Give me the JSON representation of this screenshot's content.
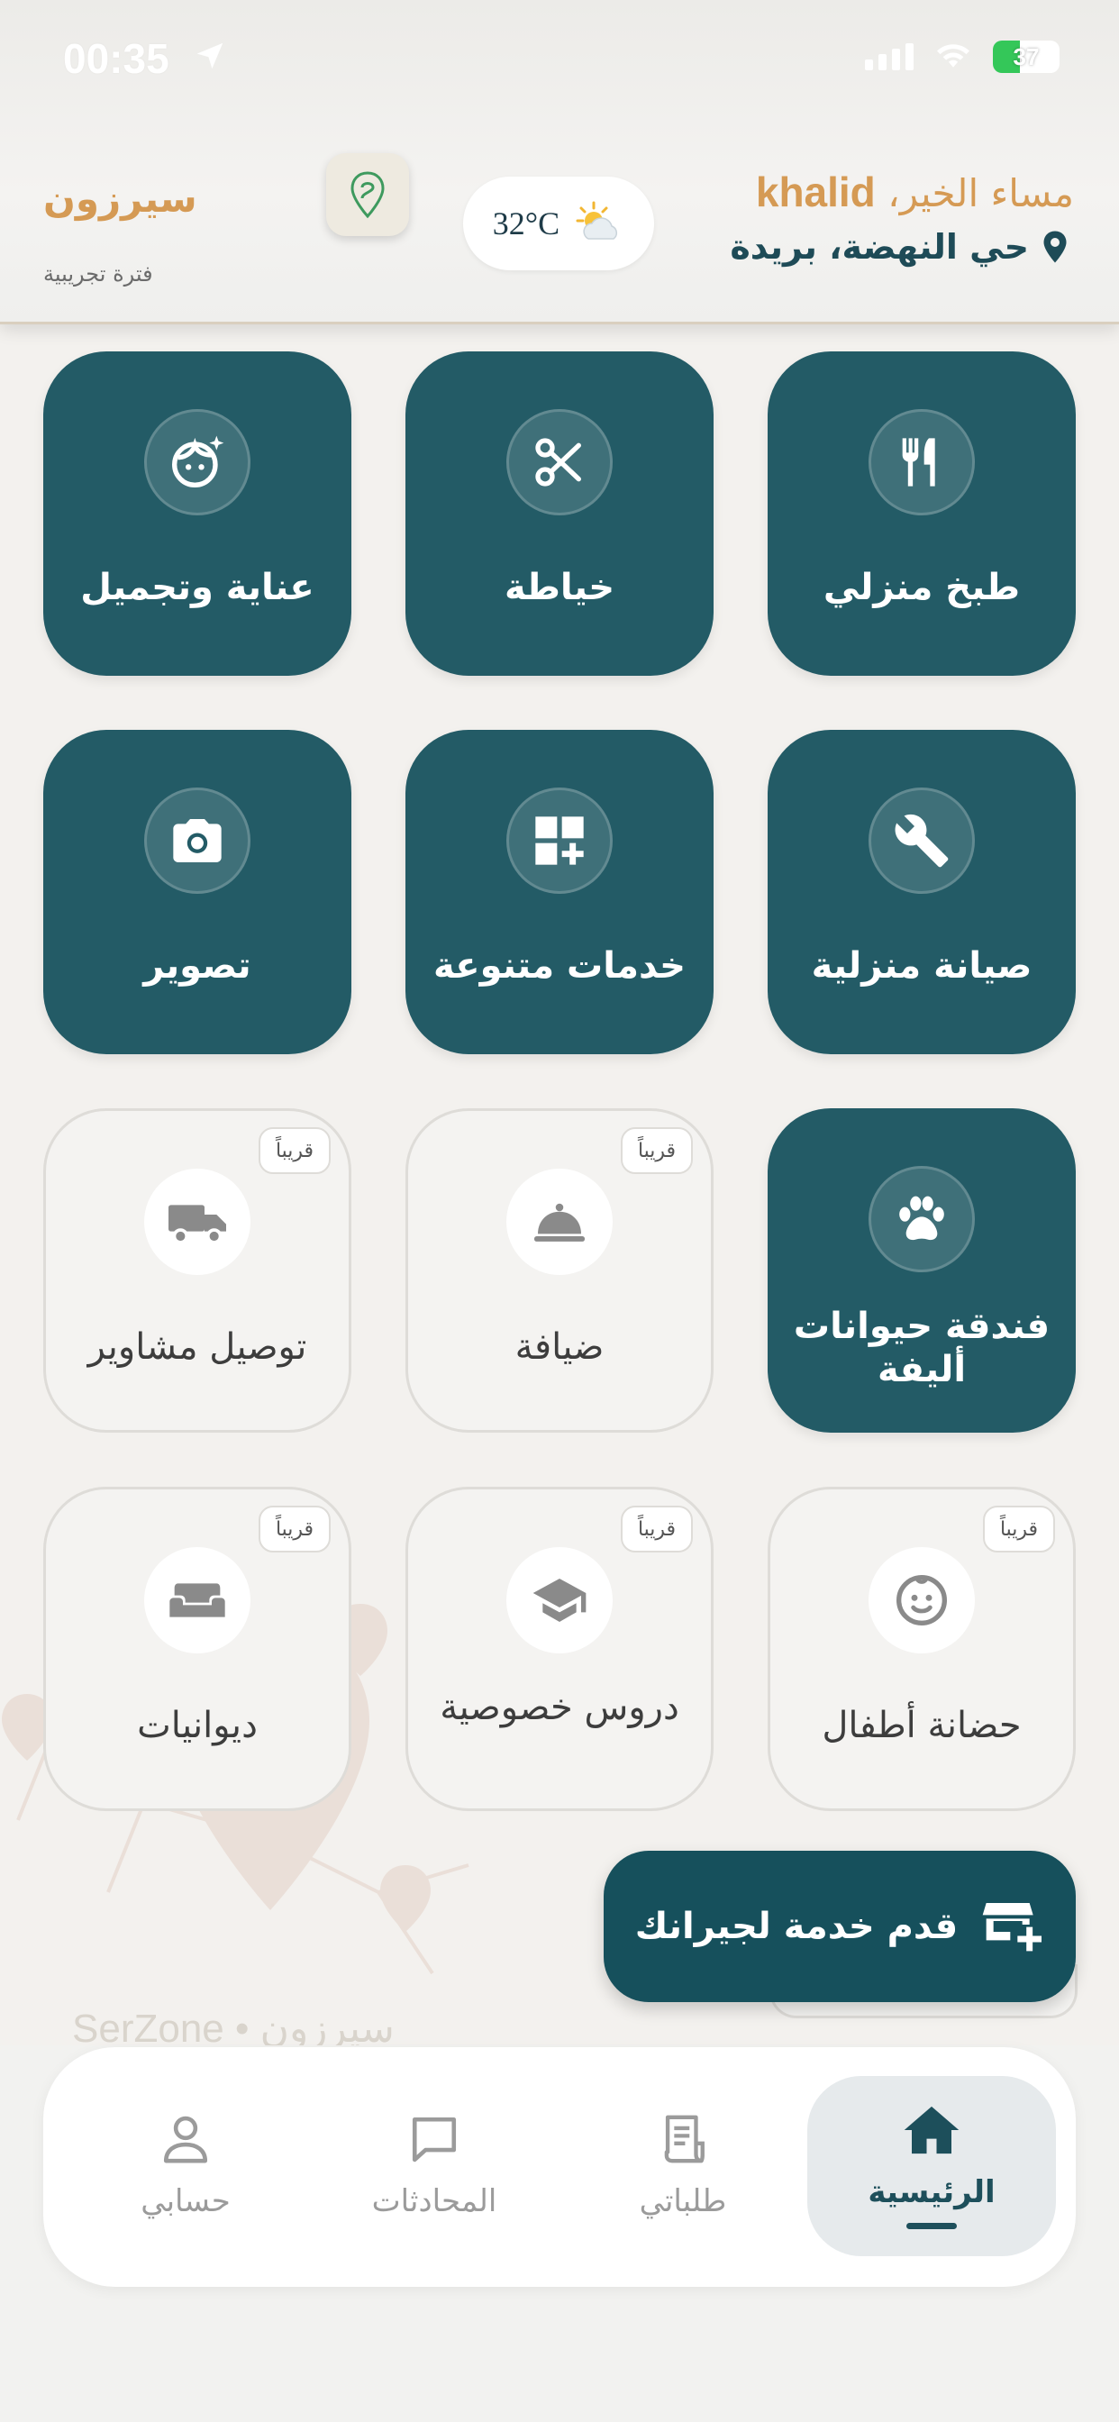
{
  "status_bar": {
    "time": "00:35",
    "battery": "37"
  },
  "header": {
    "greeting_prefix": "مساء الخير،",
    "user_name": "khalid",
    "location": "حي النهضة، بريدة",
    "temperature": "32°C",
    "brand": "سيرزون",
    "trial": "فترة تجريبية"
  },
  "services": [
    {
      "label": "طبخ منزلي",
      "icon": "fork-knife-icon",
      "status": "active"
    },
    {
      "label": "خياطة",
      "icon": "scissors-icon",
      "status": "active"
    },
    {
      "label": "عناية وتجميل",
      "icon": "face-sparkle-icon",
      "status": "active"
    },
    {
      "label": "صيانة منزلية",
      "icon": "wrench-icon",
      "status": "active"
    },
    {
      "label": "خدمات متنوعة",
      "icon": "grid-plus-icon",
      "status": "active"
    },
    {
      "label": "تصوير",
      "icon": "camera-icon",
      "status": "active"
    },
    {
      "label": "فندقة حيوانات أليفة",
      "icon": "paw-icon",
      "status": "active"
    },
    {
      "label": "ضيافة",
      "icon": "cloche-icon",
      "status": "soon"
    },
    {
      "label": "توصيل مشاوير",
      "icon": "truck-icon",
      "status": "soon"
    },
    {
      "label": "حضانة أطفال",
      "icon": "baby-face-icon",
      "status": "soon"
    },
    {
      "label": "دروس خصوصية",
      "icon": "graduation-cap-icon",
      "status": "soon"
    },
    {
      "label": "ديوانيات",
      "icon": "sofa-icon",
      "status": "soon"
    }
  ],
  "soon_badge": "قريباً",
  "offer_button": {
    "label": "قدم خدمة لجيرانك"
  },
  "watermark": "SerZone • سيرزون",
  "bottom_nav": [
    {
      "label": "الرئيسية",
      "icon": "home-icon",
      "selected": true
    },
    {
      "label": "طلباتي",
      "icon": "receipt-icon",
      "selected": false
    },
    {
      "label": "المحادثات",
      "icon": "chat-icon",
      "selected": false
    },
    {
      "label": "حسابي",
      "icon": "person-icon",
      "selected": false
    }
  ],
  "colors": {
    "primary": "#235b66",
    "accent": "#d59a54",
    "background": "#f3f1ee"
  }
}
